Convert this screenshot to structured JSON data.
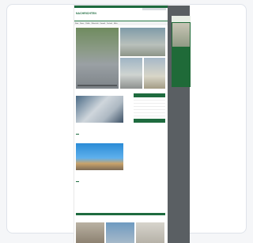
{
  "site": {
    "logo": "NACHRICHTEN",
    "tagline": "",
    "nav": [
      "Start",
      "News",
      "Politik",
      "Wirtschaft",
      "Umwelt",
      "Technik",
      "Mehr"
    ],
    "hero": {
      "main_caption": "",
      "tiles": [
        "",
        "",
        ""
      ]
    },
    "section_label": "",
    "articles": [
      {
        "headline": "",
        "excerpt": "",
        "button": ""
      },
      {
        "headline": "",
        "excerpt": "",
        "button": ""
      }
    ],
    "sidebar": {
      "heading": "",
      "items": [
        "",
        "",
        "",
        "",
        "",
        ""
      ],
      "button": ""
    },
    "footer_label": ""
  },
  "ad": {
    "brand": "",
    "text": ""
  },
  "colors": {
    "brand_green": "#1e6b3f",
    "rail_gray": "#5a5f63"
  }
}
